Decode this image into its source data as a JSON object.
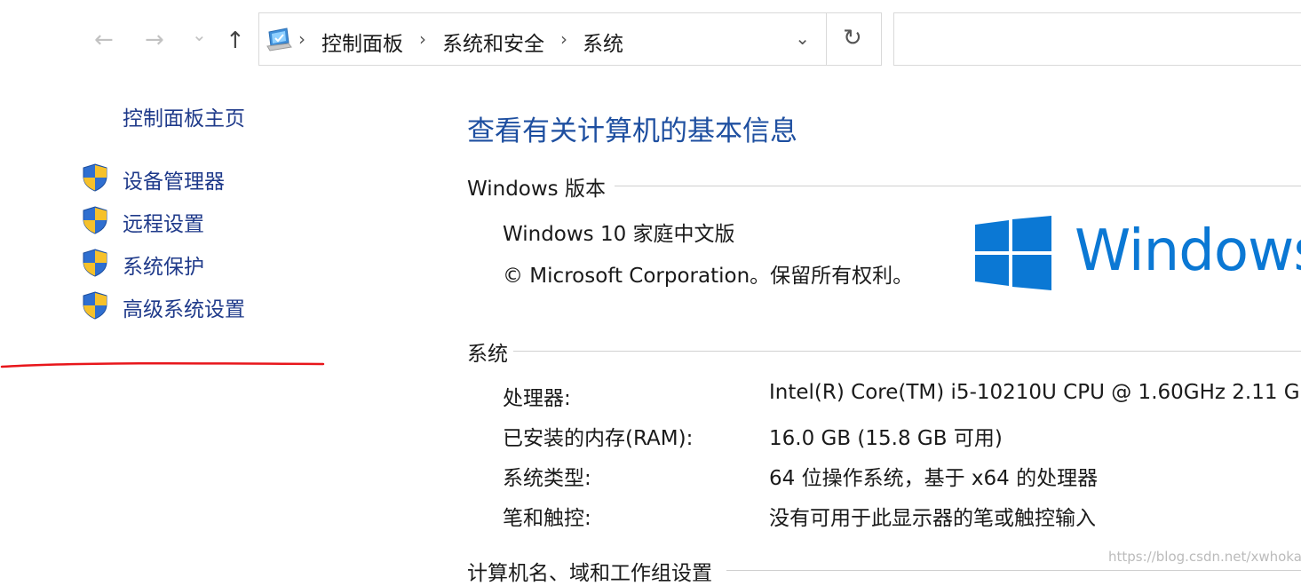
{
  "nav": {
    "back_icon": "arrow-left-icon",
    "forward_icon": "arrow-right-icon",
    "recent_icon": "chevron-down-icon",
    "up_icon": "arrow-up-icon",
    "back": "←",
    "forward": "→",
    "recent": "⌄",
    "up": "↑"
  },
  "address_bar": {
    "icon": "control-panel-icon",
    "breadcrumbs": [
      "控制面板",
      "系统和安全",
      "系统"
    ],
    "separator": "›",
    "dropdown": "⌄",
    "refresh": "↻"
  },
  "search": {
    "placeholder": ""
  },
  "sidebar": {
    "home_label": "控制面板主页",
    "items": [
      {
        "label": "设备管理器",
        "icon": "uac-shield-icon"
      },
      {
        "label": "远程设置",
        "icon": "uac-shield-icon"
      },
      {
        "label": "系统保护",
        "icon": "uac-shield-icon"
      },
      {
        "label": "高级系统设置",
        "icon": "uac-shield-icon"
      }
    ],
    "annotation_color": "#e8161b"
  },
  "main": {
    "title": "查看有关计算机的基本信息",
    "windows_edition": {
      "heading": "Windows 版本",
      "edition": "Windows 10 家庭中文版",
      "copyright": "© Microsoft Corporation。保留所有权利。",
      "logo_text": "Windows",
      "logo_icon": "windows-logo-icon",
      "logo_color": "#0b78d4"
    },
    "system": {
      "heading": "系统",
      "rows": [
        {
          "label": "处理器:",
          "value": "Intel(R) Core(TM) i5-10210U CPU @ 1.60GHz   2.11 G"
        },
        {
          "label": "已安装的内存(RAM):",
          "value": "16.0 GB (15.8 GB 可用)"
        },
        {
          "label": "系统类型:",
          "value": "64 位操作系统，基于 x64 的处理器"
        },
        {
          "label": "笔和触控:",
          "value": "没有可用于此显示器的笔或触控输入"
        }
      ]
    },
    "computer_name": {
      "heading": "计算机名、域和工作组设置"
    }
  },
  "watermark": "https://blog.csdn.net/xwhokay"
}
